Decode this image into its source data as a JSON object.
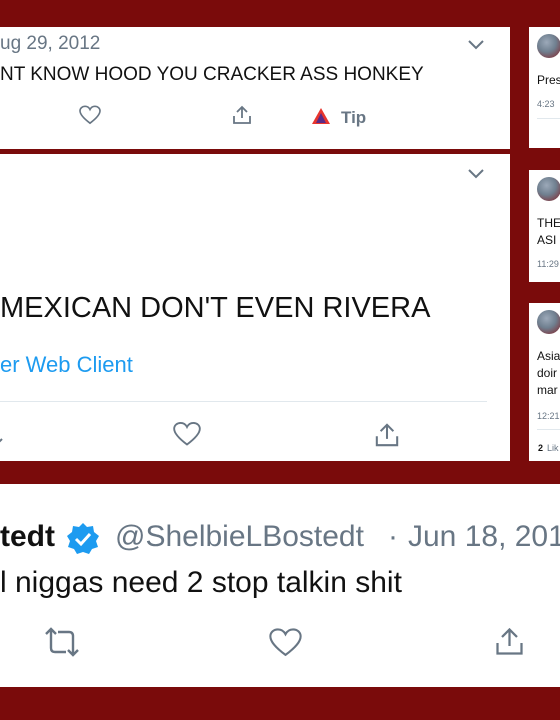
{
  "panel_a": {
    "date": "ug 29, 2012",
    "text": "NT KNOW HOOD YOU CRACKER ASS HONKEY",
    "tip_label": "Tip"
  },
  "panel_b": {
    "text": "MEXICAN DON'T EVEN RIVERA",
    "source": "er Web Client"
  },
  "panel_c": {
    "tweets": [
      {
        "text": "Pres",
        "time": "4:23"
      },
      {
        "text_line1": "THE",
        "text_line2": "ASI",
        "time": "11:29"
      },
      {
        "text_line1": "Asia",
        "text_line2": "doir",
        "text_line3": "mar",
        "time": "12:21",
        "likes_count": "2",
        "likes_label": "Lik"
      }
    ]
  },
  "panel_d": {
    "display_name": "tedt",
    "handle": "@ShelbieLBostedt",
    "separator": "·",
    "date": "Jun 18, 201",
    "text": "l niggas need 2 stop talkin shit"
  },
  "colors": {
    "background": "#7a0b0b",
    "link_blue": "#1d9bf0",
    "verified_blue": "#1d9bf0",
    "gray": "#687684"
  }
}
